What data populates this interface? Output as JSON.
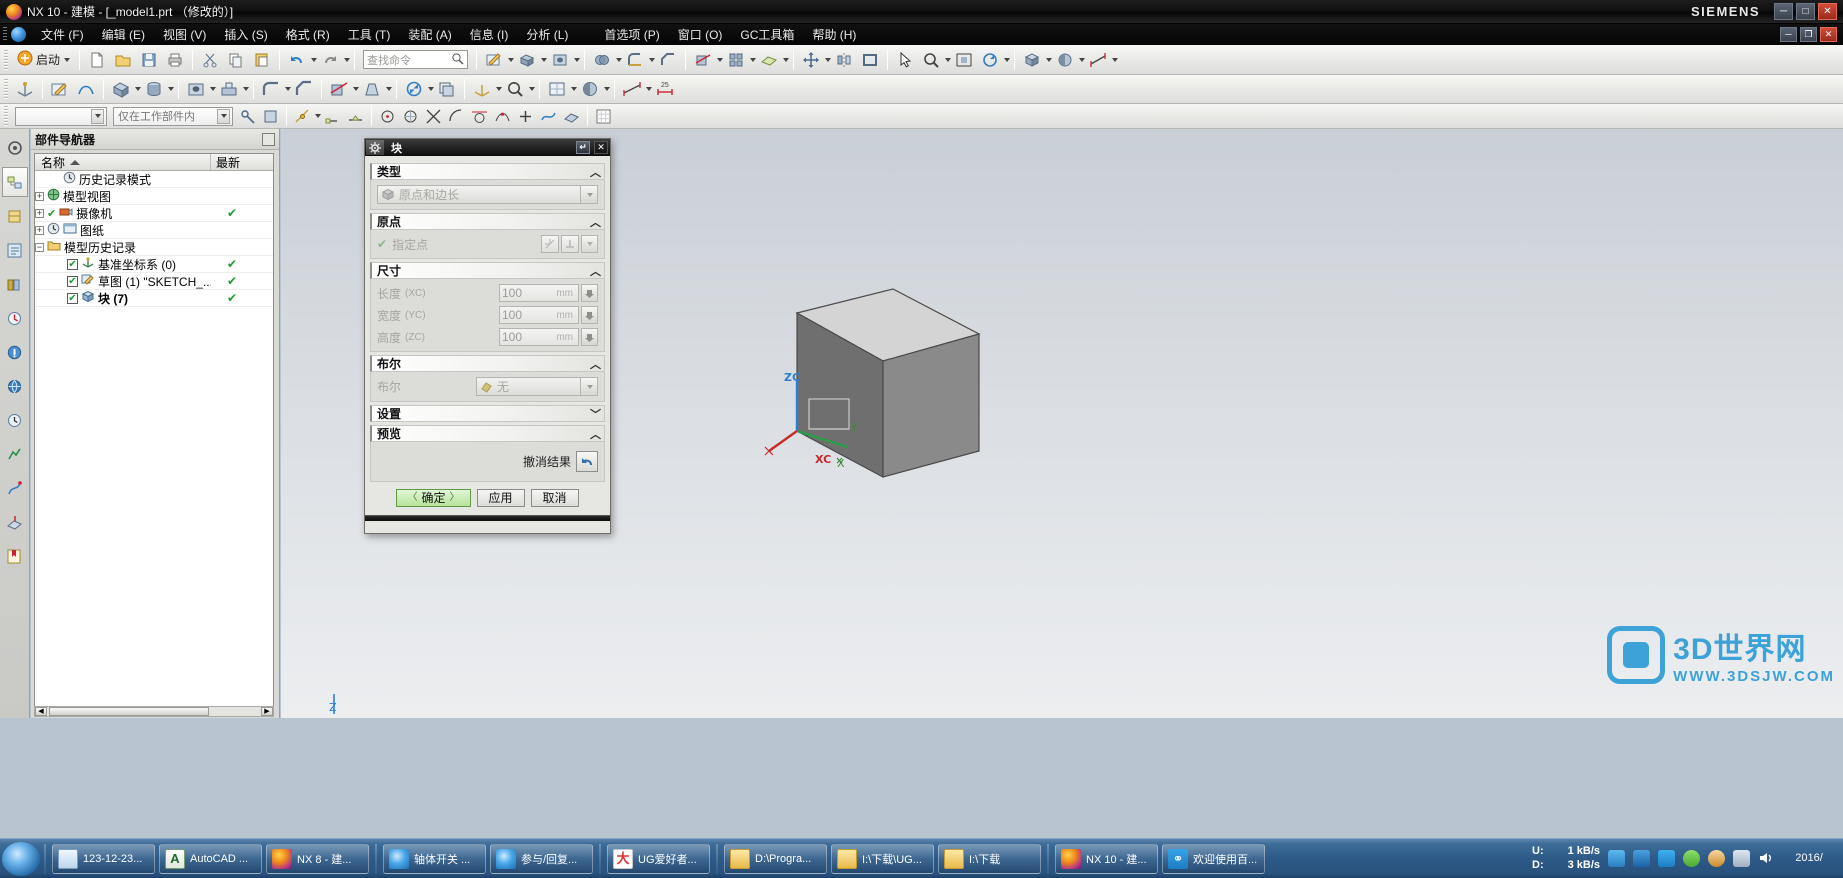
{
  "window": {
    "title": "NX 10 - 建模 - [_model1.prt （修改的）]",
    "brand": "SIEMENS",
    "controls": {
      "minimize": "─",
      "maximize": "□",
      "close": "✕"
    },
    "inner_controls": {
      "minimize": "─",
      "restore": "❐",
      "close": "✕"
    }
  },
  "menubar": {
    "items": [
      {
        "label": "文件 (F)"
      },
      {
        "label": "编辑 (E)"
      },
      {
        "label": "视图 (V)"
      },
      {
        "label": "插入 (S)"
      },
      {
        "label": "格式 (R)"
      },
      {
        "label": "工具 (T)"
      },
      {
        "label": "装配 (A)"
      },
      {
        "label": "信息 (I)"
      },
      {
        "label": "分析 (L)"
      },
      {
        "label": "首选项 (P)"
      },
      {
        "label": "窗口 (O)"
      },
      {
        "label": "GC工具箱"
      },
      {
        "label": "帮助 (H)"
      }
    ]
  },
  "toolbar": {
    "start_label": "启动",
    "command_finder_placeholder": "查找命令",
    "filter_combo_value": "仅在工作部件内",
    "type_combo_value": ""
  },
  "navigator": {
    "title": "部件导航器",
    "columns": {
      "name": "名称",
      "status": "最新"
    },
    "items": [
      {
        "label": "历史记录模式",
        "expander": "",
        "checkbox": false,
        "status": "",
        "indent": 1,
        "icon": "clock-icon"
      },
      {
        "label": "模型视图",
        "expander": "+",
        "checkbox": false,
        "status": "",
        "indent": 0,
        "icon": "model-view-icon"
      },
      {
        "label": "摄像机",
        "expander": "+",
        "checkbox": false,
        "status": "✔",
        "indent": 0,
        "icon": "camera-icon"
      },
      {
        "label": "图纸",
        "expander": "+",
        "checkbox": false,
        "status": "",
        "indent": 0,
        "icon": "drawing-icon"
      },
      {
        "label": "模型历史记录",
        "expander": "−",
        "checkbox": false,
        "status": "",
        "indent": 0,
        "icon": "folder-icon"
      },
      {
        "label": "基准坐标系 (0)",
        "expander": "",
        "checkbox": true,
        "status": "✔",
        "indent": 2,
        "icon": "datum-csys-icon"
      },
      {
        "label": "草图 (1) \"SKETCH_...",
        "expander": "",
        "checkbox": true,
        "status": "✔",
        "indent": 2,
        "icon": "sketch-icon"
      },
      {
        "label": "块 (7)",
        "expander": "",
        "checkbox": true,
        "status": "✔",
        "indent": 2,
        "icon": "block-icon"
      }
    ]
  },
  "dialog": {
    "title": "块",
    "sections": {
      "type": {
        "header": "类型",
        "chevron": "︿",
        "value": "原点和边长"
      },
      "origin": {
        "header": "原点",
        "chevron": "︿",
        "specify_point_label": "指定点",
        "check": "✔"
      },
      "dimensions": {
        "header": "尺寸",
        "chevron": "︿",
        "rows": [
          {
            "label": "长度",
            "axis": "(XC)",
            "value": "100",
            "unit": "mm"
          },
          {
            "label": "宽度",
            "axis": "(YC)",
            "value": "100",
            "unit": "mm"
          },
          {
            "label": "高度",
            "axis": "(ZC)",
            "value": "100",
            "unit": "mm"
          }
        ]
      },
      "boolean": {
        "header": "布尔",
        "chevron": "︿",
        "label": "布尔",
        "value": "无"
      },
      "settings": {
        "header": "设置",
        "chevron": "﹀"
      },
      "preview": {
        "header": "预览",
        "chevron": "︿",
        "undo_label": "撤消结果",
        "undo_icon": "undo-arrow-icon"
      }
    },
    "buttons": {
      "ok": "确定",
      "ok_prefix": "〈",
      "ok_suffix": "〉",
      "apply": "应用",
      "cancel": "取消"
    }
  },
  "viewport": {
    "axis_labels": {
      "zc": "ZC",
      "xc": "XC",
      "y": "Y",
      "x": "X",
      "z": "Z"
    }
  },
  "watermark": {
    "line1": "3D世界网",
    "line2": "WWW.3DSJW.COM"
  },
  "taskbar": {
    "items": [
      {
        "label": "123-12-23...",
        "icon": "document-icon"
      },
      {
        "label": "AutoCAD ...",
        "icon": "autocad-icon"
      },
      {
        "label": "NX 8 - 建...",
        "icon": "nx-icon"
      },
      {
        "label": "轴体开关 ...",
        "icon": "ie-icon"
      },
      {
        "label": "参与/回复...",
        "icon": "ie-icon"
      },
      {
        "label": "UG爱好者...",
        "icon": "ug-icon"
      },
      {
        "label": "D:\\Progra...",
        "icon": "folder-icon"
      },
      {
        "label": "I:\\下载\\UG...",
        "icon": "folder-icon"
      },
      {
        "label": "I:\\下载",
        "icon": "folder-icon"
      },
      {
        "label": "NX 10 - 建...",
        "icon": "nx-icon"
      },
      {
        "label": "欢迎使用百...",
        "icon": "baidu-icon"
      }
    ],
    "network": {
      "up_key": "U:",
      "up_value": "1 kB/s",
      "down_key": "D:",
      "down_value": "3 kB/s"
    },
    "clock": {
      "time": "",
      "date": "2016/"
    }
  }
}
